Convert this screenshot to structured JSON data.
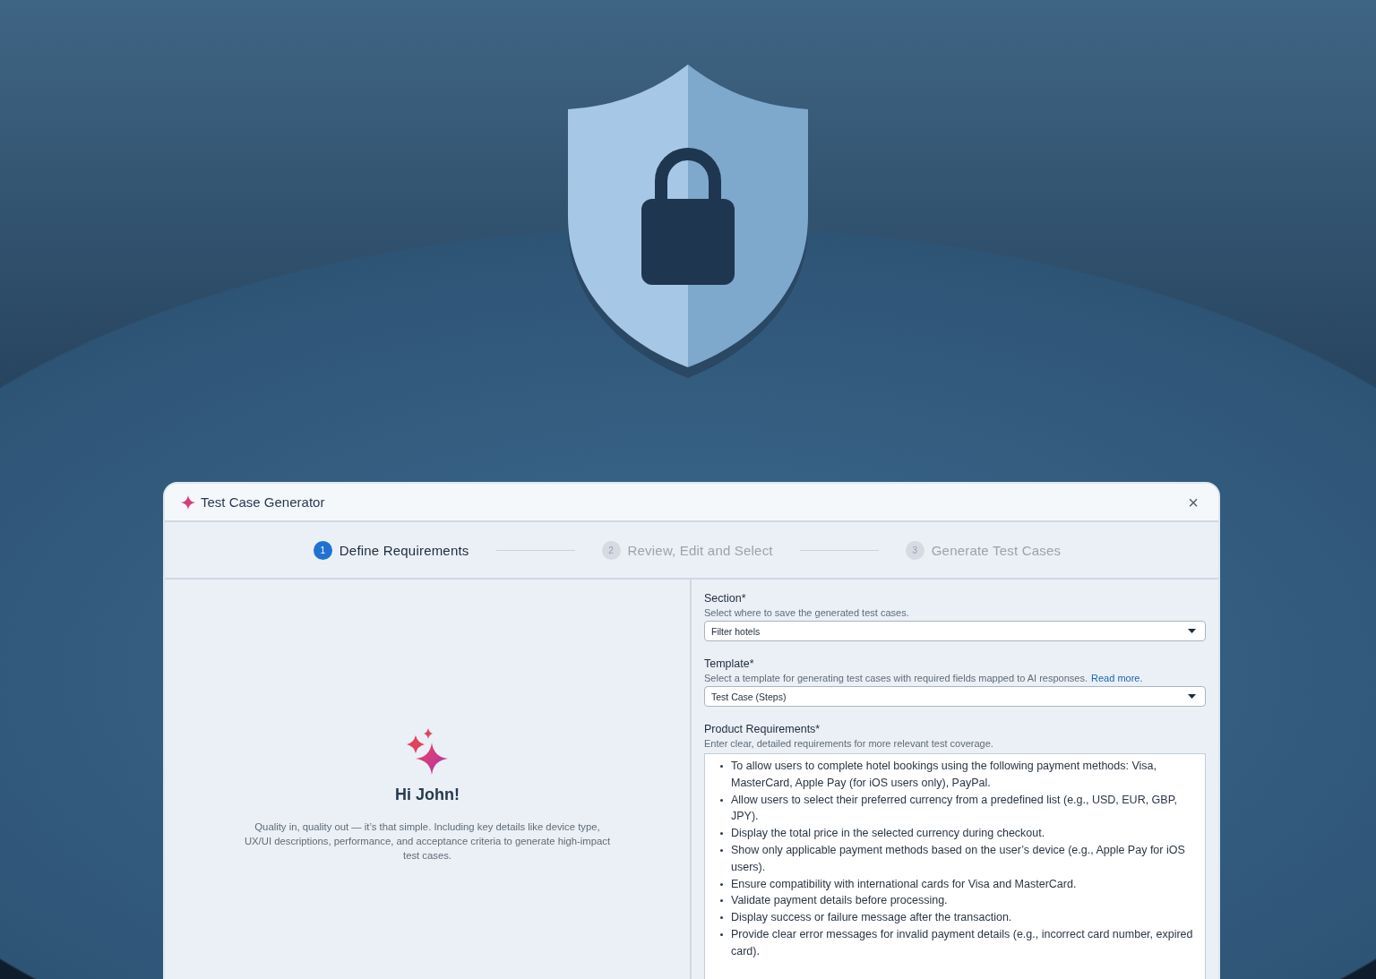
{
  "window": {
    "title": "Test Case Generator",
    "close": "×"
  },
  "steps": [
    {
      "number": "1",
      "label": "Define Requirements",
      "selected": true
    },
    {
      "number": "2",
      "label": "Review, Edit and Select",
      "selected": false
    },
    {
      "number": "3",
      "label": "Generate Test Cases",
      "selected": false
    }
  ],
  "welcome": {
    "heading": "Hi John!",
    "text": "Quality in, quality out — it’s that simple. Including key details like device type, UX/UI descriptions, performance, and acceptance criteria to generate high-impact test cases."
  },
  "form": {
    "fields": [
      {
        "kind": "select",
        "label": "Section*",
        "hint": "Select where to save the generated test cases.",
        "value": "Filter hotels"
      },
      {
        "kind": "select",
        "label": "Template*",
        "hint": "Select a template for generating test cases with required fields mapped to AI responses.",
        "link": "Read more.",
        "value": "Test Case (Steps)"
      },
      {
        "kind": "list",
        "label": "Product Requirements*",
        "hint": "Enter clear, detailed requirements for more relevant test coverage.",
        "items": [
          "To allow users to complete hotel bookings using the following payment methods: Visa, MasterCard, Apple Pay (for iOS users only), PayPal.",
          "Allow users to select their preferred currency from a predefined list (e.g., USD, EUR, GBP, JPY).",
          "Display the total price in the selected currency during checkout.",
          "Show only applicable payment methods based on the user’s device (e.g., Apple Pay for iOS users).",
          "Ensure compatibility with international cards for Visa and MasterCard.",
          "Validate payment details before processing.",
          "Display success or failure message after the transaction.",
          "Provide clear error messages for invalid payment details (e.g., incorrect card number, expired card)."
        ]
      }
    ]
  }
}
